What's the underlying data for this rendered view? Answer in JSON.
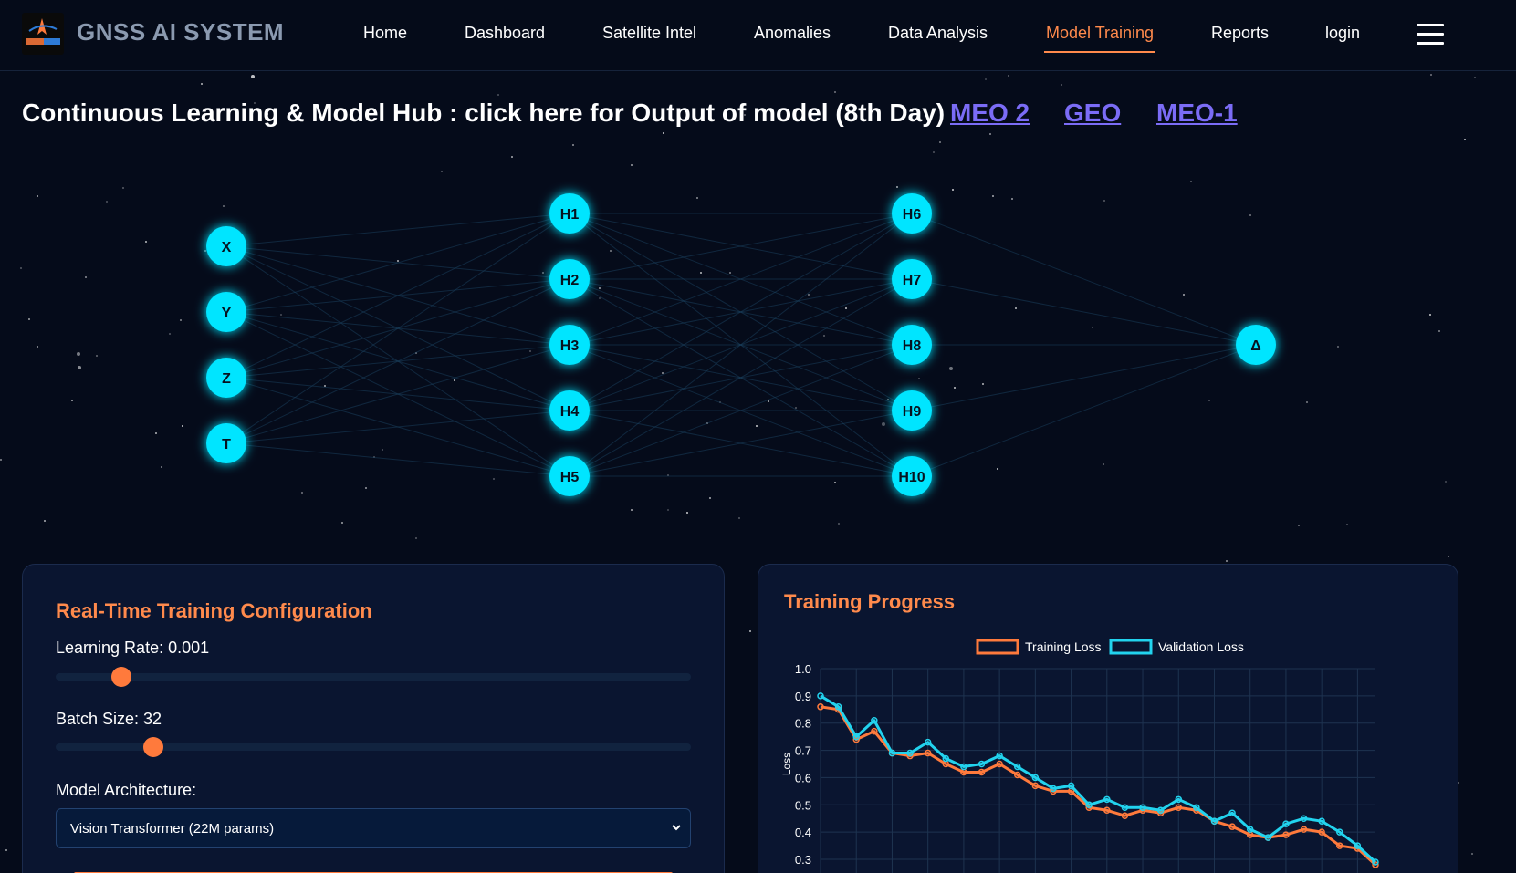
{
  "nav": {
    "brand": "GNSS AI SYSTEM",
    "links": [
      {
        "label": "Home"
      },
      {
        "label": "Dashboard"
      },
      {
        "label": "Satellite Intel"
      },
      {
        "label": "Anomalies"
      },
      {
        "label": "Data Analysis"
      },
      {
        "label": "Model Training",
        "active": true
      },
      {
        "label": "Reports"
      },
      {
        "label": "login"
      }
    ],
    "menu_icon": "hamburger-menu-icon"
  },
  "headline": {
    "text": "Continuous Learning & Model Hub : click here for Output of model (8th Day)",
    "links": [
      "MEO 2",
      "GEO",
      "MEO-1"
    ]
  },
  "network": {
    "input_nodes": [
      "X",
      "Y",
      "Z",
      "T"
    ],
    "hidden_layer_1": [
      "H1",
      "H2",
      "H3",
      "H4",
      "H5"
    ],
    "hidden_layer_2": [
      "H6",
      "H7",
      "H8",
      "H9",
      "H10"
    ],
    "output_nodes": [
      "Δ"
    ],
    "node_color": "#00e5ff"
  },
  "config": {
    "title": "Real-Time Training Configuration",
    "learning_rate_label": "Learning Rate: 0.001",
    "learning_rate_position": 0.104,
    "batch_size_label": "Batch Size: 32",
    "batch_size_position": 0.154,
    "architecture_label": "Model Architecture:",
    "architecture_value": "Vision Transformer (22M params)"
  },
  "progress": {
    "title": "Training Progress"
  },
  "chart_data": {
    "type": "line",
    "title": "",
    "xlabel": "",
    "ylabel": "Loss",
    "ylim": [
      0.3,
      1.0
    ],
    "yticks": [
      "1.0",
      "0.9",
      "0.8",
      "0.7",
      "0.6",
      "0.5",
      "0.4",
      "0.3"
    ],
    "grid": true,
    "legend_position": "top-center",
    "series": [
      {
        "name": "Training Loss",
        "color": "#ff7a3c",
        "values": [
          0.86,
          0.85,
          0.74,
          0.77,
          0.69,
          0.68,
          0.69,
          0.65,
          0.62,
          0.62,
          0.65,
          0.61,
          0.57,
          0.55,
          0.55,
          0.49,
          0.48,
          0.46,
          0.48,
          0.47,
          0.49,
          0.48,
          0.44,
          0.42,
          0.39,
          0.38,
          0.39,
          0.41,
          0.4,
          0.35,
          0.34,
          0.28
        ]
      },
      {
        "name": "Validation Loss",
        "color": "#22d3ee",
        "values": [
          0.9,
          0.86,
          0.75,
          0.81,
          0.69,
          0.69,
          0.73,
          0.67,
          0.64,
          0.65,
          0.68,
          0.64,
          0.6,
          0.56,
          0.57,
          0.5,
          0.52,
          0.49,
          0.49,
          0.48,
          0.52,
          0.49,
          0.44,
          0.47,
          0.41,
          0.38,
          0.43,
          0.45,
          0.44,
          0.4,
          0.35,
          0.29
        ]
      }
    ]
  }
}
